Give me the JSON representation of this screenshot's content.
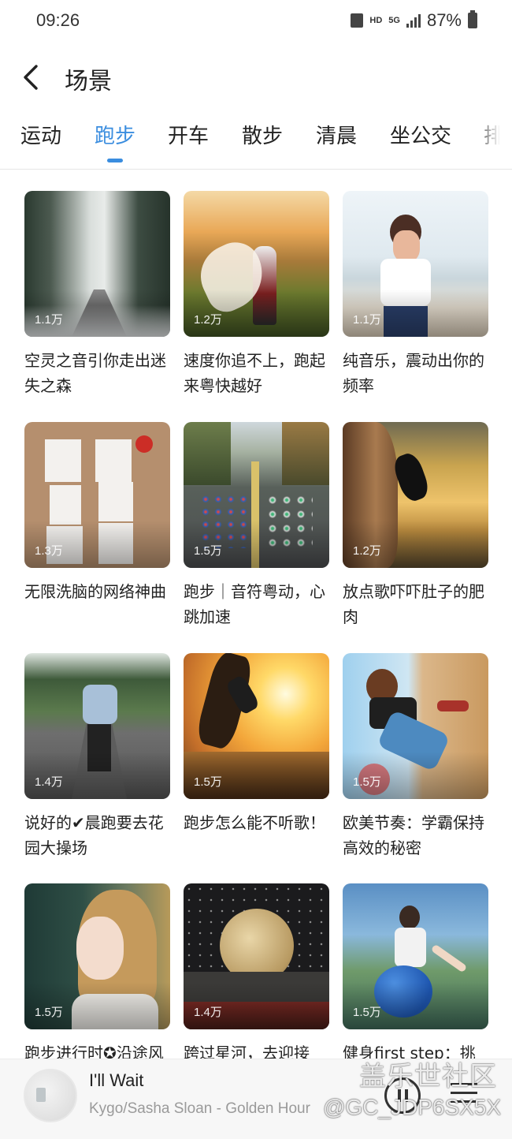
{
  "status_bar": {
    "time": "09:26",
    "hd": "HD",
    "network": "5G",
    "battery": "87%"
  },
  "header": {
    "title": "场景"
  },
  "tabs": [
    {
      "label": "运动"
    },
    {
      "label": "跑步",
      "active": true
    },
    {
      "label": "开车"
    },
    {
      "label": "散步"
    },
    {
      "label": "清晨"
    },
    {
      "label": "坐公交"
    },
    {
      "label": "排"
    }
  ],
  "playlists": [
    {
      "title": "空灵之音引你走出迷失之森",
      "count": "1.1万"
    },
    {
      "title": "速度你追不上，跑起来粤快越好",
      "count": "1.2万"
    },
    {
      "title": "纯音乐，震动出你的频率",
      "count": "1.1万"
    },
    {
      "title": "无限洗脑的网络神曲",
      "count": "1.3万"
    },
    {
      "title": "跑步｜音符粤动，心跳加速",
      "count": "1.5万"
    },
    {
      "title": "放点歌吓吓肚子的肥肉",
      "count": "1.2万"
    },
    {
      "title": "说好的✔晨跑要去花园大操场",
      "count": "1.4万"
    },
    {
      "title": "跑步怎么能不听歌！",
      "count": "1.5万"
    },
    {
      "title": "欧美节奏：学霸保持高效的秘密",
      "count": "1.5万"
    },
    {
      "title": "跑步进行时✪沿途风景",
      "count": "1.5万"
    },
    {
      "title": "跨过星河，去迎接",
      "count": "1.4万"
    },
    {
      "title": "健身first step：挑",
      "count": "1.5万"
    }
  ],
  "player": {
    "song_title": "I'll Wait",
    "artist": "Kygo/Sasha Sloan - Golden Hour"
  },
  "watermark": {
    "line1": "盖乐世社区",
    "line2": "@GC_JDP6SX5X"
  }
}
